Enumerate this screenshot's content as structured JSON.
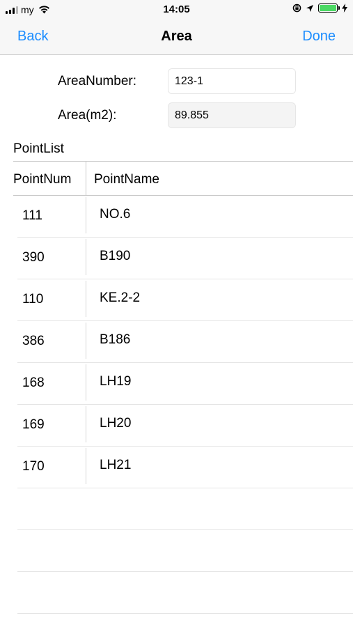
{
  "status_bar": {
    "carrier": "my",
    "time": "14:05",
    "battery_level": 1.0
  },
  "nav": {
    "back_label": "Back",
    "title": "Area",
    "done_label": "Done"
  },
  "form": {
    "area_number_label": "AreaNumber:",
    "area_number_value": "123-1",
    "area_label": "Area(m2):",
    "area_value": "89.855"
  },
  "point_list": {
    "title": "PointList",
    "columns": [
      "PointNum",
      "PointName"
    ],
    "rows": [
      {
        "num": "111",
        "name": "NO.6"
      },
      {
        "num": "390",
        "name": "B190"
      },
      {
        "num": "110",
        "name": "KE.2-2"
      },
      {
        "num": "386",
        "name": "B186"
      },
      {
        "num": "168",
        "name": "LH19"
      },
      {
        "num": "169",
        "name": "LH20"
      },
      {
        "num": "170",
        "name": "LH21"
      }
    ]
  },
  "colors": {
    "accent": "#1a8cff",
    "battery": "#4cd964"
  }
}
